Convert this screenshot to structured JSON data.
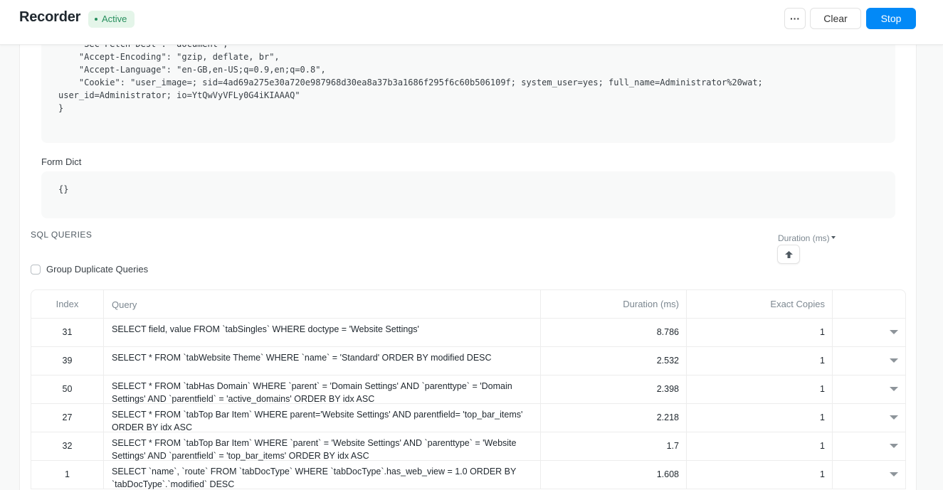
{
  "header": {
    "title": "Recorder",
    "status": "Active",
    "more_label": "···",
    "clear_label": "Clear",
    "stop_label": "Stop",
    "colors": {
      "accent": "#0289f7",
      "status_bg": "#e4f5e9",
      "status_fg": "#278f5e"
    }
  },
  "request_headers": {
    "lines": [
      "    \"Sec-Fetch-Dest\": \"document\",",
      "    \"Accept-Encoding\": \"gzip, deflate, br\",",
      "    \"Accept-Language\": \"en-GB,en-US;q=0.9,en;q=0.8\",",
      "    \"Cookie\": \"user_image=; sid=4ad69a275e30a720e987968d30ea8a37b3a1686f295f6c60b506109f; system_user=yes; full_name=Administrator%20wat;",
      "user_id=Administrator; io=YtQwVyVFLy0G4iKIAAAQ\"",
      "}"
    ]
  },
  "form_dict": {
    "label": "Form Dict",
    "value": "{}"
  },
  "sql": {
    "title": "SQL QUERIES",
    "sort_by_label": "Duration (ms)",
    "sort_direction_icon": "arrow-up-icon",
    "group_duplicates_label": "Group Duplicate Queries",
    "group_duplicates_checked": false,
    "columns": [
      "Index",
      "Query",
      "Duration (ms)",
      "Exact Copies",
      ""
    ],
    "rows": [
      {
        "index": "31",
        "query": "SELECT field, value FROM `tabSingles` WHERE doctype = 'Website Settings'",
        "duration": "8.786",
        "copies": "1"
      },
      {
        "index": "39",
        "query": "SELECT * FROM `tabWebsite Theme` WHERE `name` = 'Standard' ORDER BY modified DESC",
        "duration": "2.532",
        "copies": "1"
      },
      {
        "index": "50",
        "query": "SELECT * FROM `tabHas Domain` WHERE `parent` = 'Domain Settings' AND `parenttype` = 'Domain Settings' AND `parentfield` = 'active_domains' ORDER BY idx ASC",
        "duration": "2.398",
        "copies": "1"
      },
      {
        "index": "27",
        "query": "SELECT * FROM `tabTop Bar Item` WHERE parent='Website Settings' AND parentfield= 'top_bar_items' ORDER BY idx ASC",
        "duration": "2.218",
        "copies": "1"
      },
      {
        "index": "32",
        "query": "SELECT * FROM `tabTop Bar Item` WHERE `parent` = 'Website Settings' AND `parenttype` = 'Website Settings' AND `parentfield` = 'top_bar_items' ORDER BY idx ASC",
        "duration": "1.7",
        "copies": "1"
      },
      {
        "index": "1",
        "query": "SELECT `name`, `route` FROM `tabDocType` WHERE `tabDocType`.has_web_view = 1.0 ORDER BY `tabDocType`.`modified` DESC",
        "duration": "1.608",
        "copies": "1"
      }
    ]
  }
}
